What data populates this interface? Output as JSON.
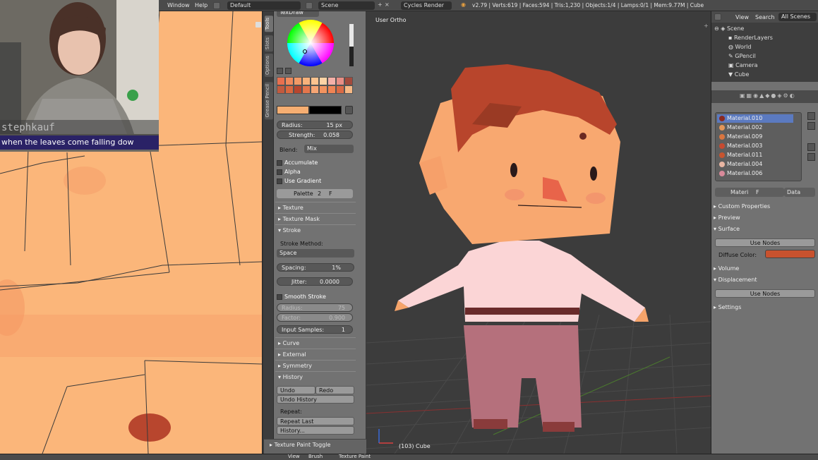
{
  "topbar": {
    "menu_window": "Window",
    "menu_help": "Help",
    "layout": "Default",
    "scene": "Scene",
    "engine": "Cycles Render",
    "stats": "v2.79 | Verts:619 | Faces:594 | Tris:1,230 | Objects:1/4 | Lamps:0/1 | Mem:9.77M | Cube"
  },
  "webcam": {
    "username": "stephkauf",
    "now_playing": "when the leaves come falling dow"
  },
  "tool_tabs": [
    "Tools",
    "Slots",
    "Options",
    "Grease Pencil"
  ],
  "tools": {
    "brush_name": "TexDraw",
    "radius_label": "Radius:",
    "radius_value": "15 px",
    "strength_label": "Strength:",
    "strength_value": "0.058",
    "blend_label": "Blend:",
    "blend_value": "Mix",
    "accumulate": "Accumulate",
    "alpha": "Alpha",
    "use_gradient": "Use Gradient",
    "palette_label": "Palette",
    "palette_users": "2",
    "palette_f": "F",
    "palette_colors": [
      "#e8704f",
      "#f08a5c",
      "#f29a66",
      "#f7b27b",
      "#fbc38f",
      "#fdd4a6",
      "#f4b0a8",
      "#e88f86",
      "#a24a3c",
      "#c25a3e",
      "#d9683f",
      "#b8462e",
      "#e4764c",
      "#f6a574",
      "#f2935f",
      "#ef8454",
      "#d96a45",
      "#f7b985"
    ],
    "color_swatch_primary": "#f6ae72",
    "color_swatch_secondary": "#000000",
    "sections": {
      "texture": "Texture",
      "texture_mask": "Texture Mask",
      "stroke": "Stroke",
      "curve": "Curve",
      "external": "External",
      "symmetry": "Symmetry",
      "history": "History"
    },
    "stroke_method_label": "Stroke Method:",
    "stroke_method_value": "Space",
    "spacing_label": "Spacing:",
    "spacing_value": "1%",
    "jitter_label": "Jitter:",
    "jitter_value": "0.0000",
    "smooth_stroke": "Smooth Stroke",
    "smooth_radius_label": "Radius:",
    "smooth_radius_value": "75",
    "factor_label": "Factor:",
    "factor_value": "0.900",
    "input_samples_label": "Input Samples:",
    "input_samples_value": "1",
    "undo": "Undo",
    "redo": "Redo",
    "undo_history": "Undo History",
    "repeat_label": "Repeat:",
    "repeat_last": "Repeat Last",
    "history_btn": "History...",
    "operator_panel": "Texture Paint Toggle"
  },
  "viewport": {
    "view_label": "User Ortho",
    "object_label": "(103) Cube"
  },
  "outliner": {
    "view": "View",
    "search": "Search",
    "filter": "All Scenes",
    "items": [
      "Scene",
      "RenderLayers",
      "World",
      "GPencil",
      "Camera",
      "Cube"
    ]
  },
  "properties": {
    "materials": [
      {
        "name": "Material.010",
        "color": "#8a2a22"
      },
      {
        "name": "Material.002",
        "color": "#e39659"
      },
      {
        "name": "Material.009",
        "color": "#d9753f"
      },
      {
        "name": "Material.003",
        "color": "#c64a30"
      },
      {
        "name": "Material.011",
        "color": "#c7542f"
      },
      {
        "name": "Material.004",
        "color": "#e9b6a3"
      },
      {
        "name": "Material.006",
        "color": "#d98a9a"
      }
    ],
    "material_field": "Materi",
    "material_f": "F",
    "data_label": "Data",
    "custom_properties": "Custom Properties",
    "preview": "Preview",
    "surface": "Surface",
    "use_nodes": "Use Nodes",
    "diffuse_color_label": "Diffuse Color:",
    "diffuse_color": "#c8522e",
    "volume": "Volume",
    "displacement": "Displacement",
    "use_nodes_2": "Use Nodes",
    "settings": "Settings"
  },
  "bottombar": {
    "view": "View",
    "brush": "Brush",
    "mode": "Texture Paint"
  }
}
